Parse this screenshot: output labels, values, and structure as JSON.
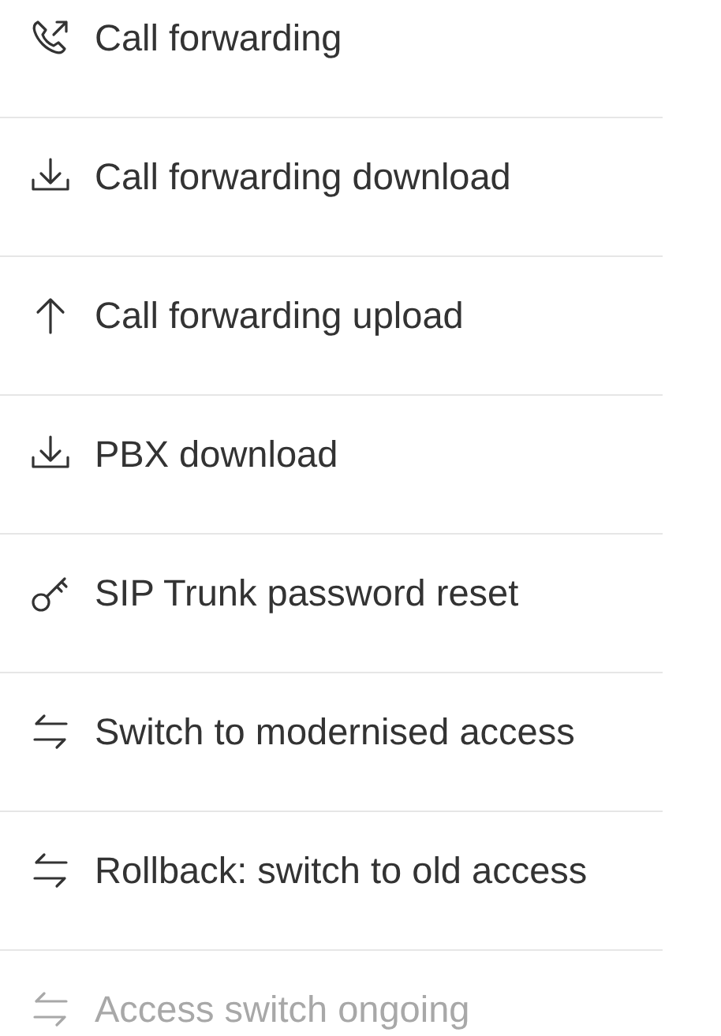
{
  "menu": {
    "items": [
      {
        "kind": "forwarding",
        "label": "Call forwarding",
        "disabled": false
      },
      {
        "kind": "download",
        "label": "Call forwarding download",
        "disabled": false
      },
      {
        "kind": "upload",
        "label": "Call forwarding upload",
        "disabled": false
      },
      {
        "kind": "download",
        "label": "PBX download",
        "disabled": false
      },
      {
        "kind": "password",
        "label": "SIP Trunk password reset",
        "disabled": false
      },
      {
        "kind": "switch",
        "label": "Switch to modernised access",
        "disabled": false
      },
      {
        "kind": "switch",
        "label": "Rollback: switch to old access",
        "disabled": false
      },
      {
        "kind": "switch",
        "label": "Access switch ongoing",
        "disabled": true
      }
    ]
  }
}
